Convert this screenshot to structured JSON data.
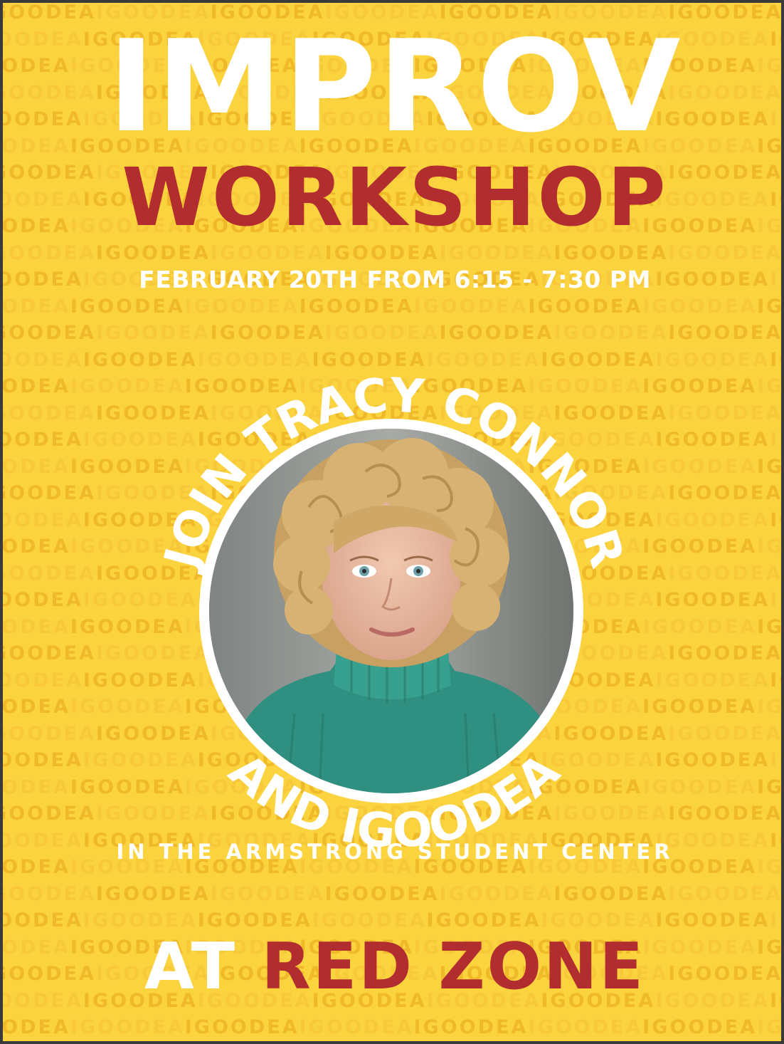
{
  "poster": {
    "title_line1": "IMPROV",
    "title_line2": "WORKSHOP",
    "datetime": "FEBRUARY 20TH FROM 6:15 - 7:30 PM",
    "ring_top": "JOIN TRACY CONNOR",
    "ring_bottom": "AND IGOODEA",
    "location": "IN THE ARMSTRONG STUDENT CENTER",
    "room_prefix": "AT",
    "room_name": "RED ZONE",
    "background_pattern_text": "IGOODEA",
    "photo_subject": "portrait-of-tracy-connor"
  },
  "colors": {
    "background": "#fbd33f",
    "pattern": "#f0b92a",
    "accent_red": "#b22d2f",
    "white": "#ffffff",
    "frame": "#3a3a3a"
  }
}
